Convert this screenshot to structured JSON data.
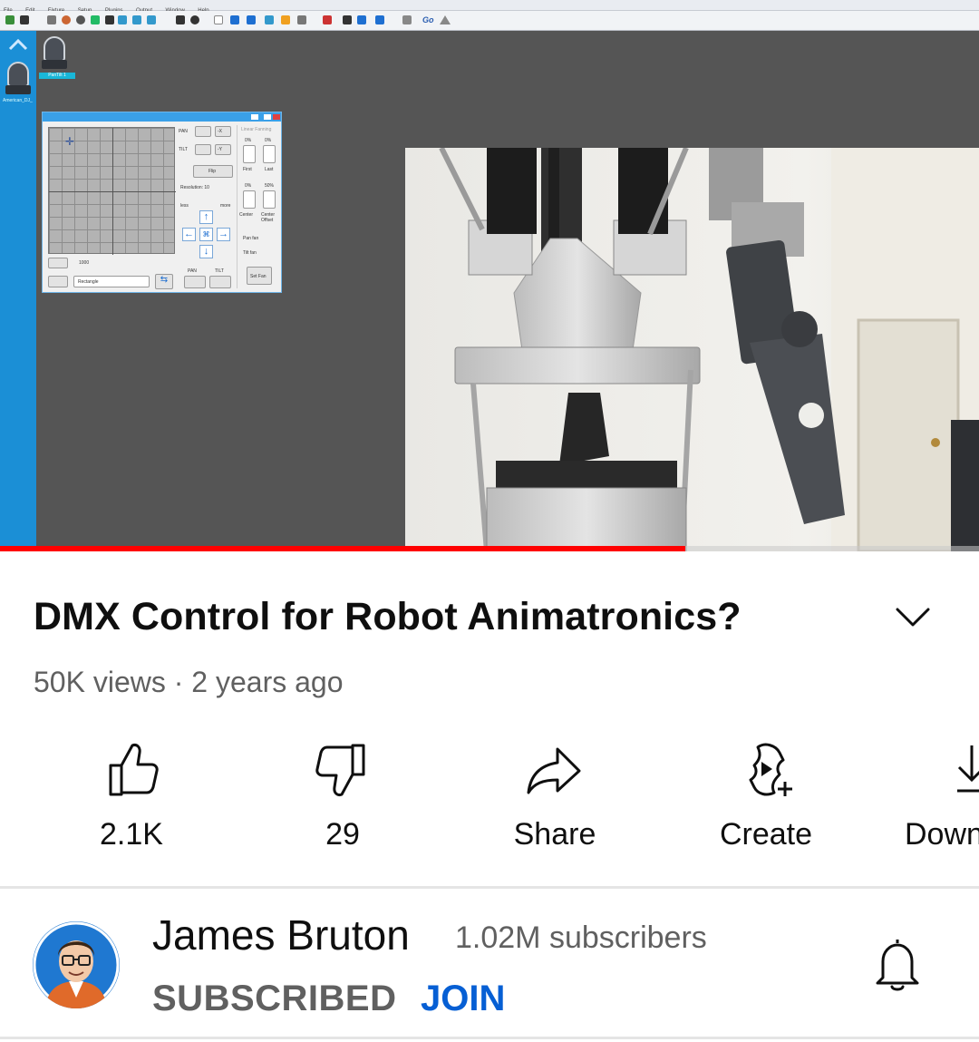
{
  "video": {
    "app_menu": [
      "File",
      "Edit",
      "Fixture",
      "Setup",
      "Plugins",
      "Output",
      "Window",
      "Help"
    ],
    "toolbar_go_label": "Go",
    "fixtures": [
      {
        "label": "American_DJ_"
      },
      {
        "label": "PanTilt 1"
      }
    ],
    "pan_tilt_panel": {
      "pan_label": "PAN",
      "tilt_label": "TILT",
      "flip_label": "Flip",
      "resolution_label": "Resolution: 10",
      "less_label": "less",
      "more_label": "more",
      "value": "1000",
      "shape": "Rectangle",
      "linear_fanning_label": "Linear Fanning",
      "first_label": "First",
      "last_label": "Last",
      "center_label": "Center",
      "center_offset_label": "Center Offset",
      "pan_fan_label": "Pan fan",
      "tilt_fan_label": "Tilt fan",
      "set_fan_label": "Set Fan",
      "pct_0": "0%",
      "pct_50": "50%",
      "minus_x": "-X",
      "minus_y": "-Y"
    },
    "progress_fraction": 0.7,
    "progress_color": "#ff0000"
  },
  "title": "DMX Control for Robot Animatronics?",
  "meta": "50K views · 2 years ago",
  "actions": [
    {
      "icon": "thumbs-up-icon",
      "label": "2.1K"
    },
    {
      "icon": "thumbs-down-icon",
      "label": "29"
    },
    {
      "icon": "share-icon",
      "label": "Share"
    },
    {
      "icon": "create-icon",
      "label": "Create"
    },
    {
      "icon": "download-icon",
      "label": "Down"
    }
  ],
  "channel": {
    "name": "James Bruton",
    "subscribers": "1.02M subscribers",
    "subscribed_label": "SUBSCRIBED",
    "join_label": "JOIN",
    "join_color": "#065fd4"
  }
}
